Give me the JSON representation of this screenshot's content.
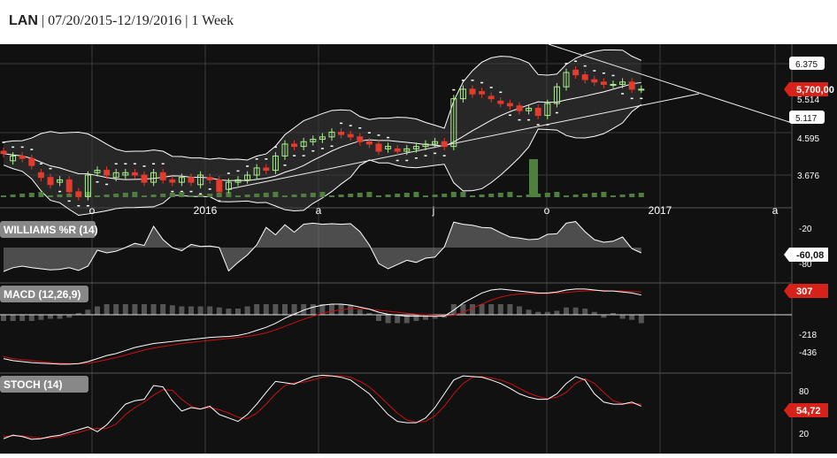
{
  "header": {
    "symbol": "LAN",
    "sep1": "|",
    "date_range": "07/20/2015-12/19/2016",
    "sep2": "|",
    "interval": "1 Week"
  },
  "chart_data": [
    {
      "panel": "price",
      "type": "candlestick",
      "y_ticks": [
        "6.375",
        "5.514",
        "5.117",
        "4.595",
        "3.676"
      ],
      "current_value_label": "5,700,00",
      "x_tick_labels": [
        "o",
        "2016",
        "a",
        "j",
        "o",
        "2017",
        "a"
      ],
      "candles": [
        [
          4.4,
          4.35
        ],
        [
          4.2,
          4.3
        ],
        [
          4.3,
          4.25
        ],
        [
          4.25,
          4.1
        ],
        [
          3.95,
          3.85
        ],
        [
          3.85,
          3.7
        ],
        [
          3.75,
          3.8
        ],
        [
          3.8,
          3.55
        ],
        [
          3.55,
          3.45
        ],
        [
          3.45,
          3.9
        ],
        [
          3.95,
          4.0
        ],
        [
          4.0,
          3.9
        ],
        [
          3.85,
          3.95
        ],
        [
          3.9,
          3.95
        ],
        [
          3.95,
          3.9
        ],
        [
          3.9,
          3.75
        ],
        [
          3.75,
          3.95
        ],
        [
          3.95,
          3.8
        ],
        [
          3.8,
          3.75
        ],
        [
          3.75,
          3.85
        ],
        [
          3.85,
          3.75
        ],
        [
          3.7,
          3.9
        ],
        [
          3.85,
          3.8
        ],
        [
          3.8,
          3.55
        ],
        [
          3.6,
          3.75
        ],
        [
          3.75,
          3.8
        ],
        [
          3.8,
          3.9
        ],
        [
          3.9,
          4.05
        ],
        [
          4.05,
          4.0
        ],
        [
          4.0,
          4.3
        ],
        [
          4.3,
          4.55
        ],
        [
          4.55,
          4.5
        ],
        [
          4.5,
          4.6
        ],
        [
          4.6,
          4.65
        ],
        [
          4.65,
          4.7
        ],
        [
          4.7,
          4.8
        ],
        [
          4.8,
          4.75
        ],
        [
          4.75,
          4.7
        ],
        [
          4.7,
          4.6
        ],
        [
          4.6,
          4.55
        ],
        [
          4.55,
          4.4
        ],
        [
          4.45,
          4.5
        ],
        [
          4.45,
          4.4
        ],
        [
          4.4,
          4.45
        ],
        [
          4.45,
          4.5
        ],
        [
          4.5,
          4.55
        ],
        [
          4.55,
          4.6
        ],
        [
          4.6,
          4.5
        ],
        [
          4.5,
          5.5
        ],
        [
          5.5,
          5.7
        ],
        [
          5.7,
          5.6
        ],
        [
          5.65,
          5.6
        ],
        [
          5.55,
          5.5
        ],
        [
          5.45,
          5.4
        ],
        [
          5.4,
          5.35
        ],
        [
          5.35,
          5.25
        ],
        [
          5.25,
          5.3
        ],
        [
          5.3,
          5.15
        ],
        [
          5.15,
          5.4
        ],
        [
          5.4,
          5.75
        ],
        [
          5.75,
          6.05
        ],
        [
          6.1,
          6.0
        ],
        [
          6.0,
          5.9
        ],
        [
          5.9,
          5.85
        ],
        [
          5.85,
          5.8
        ],
        [
          5.8,
          5.8
        ],
        [
          5.8,
          5.85
        ],
        [
          5.85,
          5.7
        ],
        [
          5.7,
          5.7
        ]
      ]
    },
    {
      "panel": "williams_r",
      "type": "line",
      "label": "WILLIAMS %R (14)",
      "y_ticks": [
        "-20",
        "-80"
      ],
      "current_value_label": "-60,08",
      "values": [
        -95,
        -88,
        -85,
        -88,
        -90,
        -92,
        -91,
        -88,
        -93,
        -85,
        -55,
        -60,
        -57,
        -50,
        -42,
        -46,
        -10,
        -35,
        -50,
        -56,
        -44,
        -48,
        -47,
        -50,
        -94,
        -78,
        -64,
        -45,
        -12,
        -26,
        -7,
        -21,
        -6,
        -4,
        -6,
        -5,
        -6,
        -5,
        -20,
        -45,
        -80,
        -90,
        -82,
        -74,
        -78,
        -70,
        -68,
        -49,
        -2,
        -6,
        -8,
        -12,
        -13,
        -22,
        -30,
        -32,
        -35,
        -34,
        -25,
        -24,
        -4,
        -1,
        -20,
        -35,
        -40,
        -38,
        -30,
        -52,
        -60
      ]
    },
    {
      "panel": "macd",
      "type": "line",
      "label": "MACD (12,26,9)",
      "y_ticks": [
        "-218",
        "-436"
      ],
      "current_value_label": "307",
      "macd": [
        -400,
        -420,
        -430,
        -440,
        -445,
        -450,
        -455,
        -455,
        -450,
        -430,
        -400,
        -370,
        -350,
        -320,
        -290,
        -270,
        -250,
        -240,
        -230,
        -220,
        -210,
        -200,
        -190,
        -185,
        -180,
        -170,
        -150,
        -120,
        -90,
        -50,
        0,
        40,
        80,
        110,
        130,
        140,
        140,
        130,
        110,
        90,
        60,
        40,
        30,
        20,
        20,
        20,
        20,
        20,
        80,
        150,
        200,
        250,
        280,
        290,
        280,
        270,
        260,
        250,
        250,
        260,
        280,
        290,
        290,
        280,
        270,
        270,
        260,
        250,
        230
      ],
      "signal": [
        -380,
        -400,
        -410,
        -420,
        -430,
        -440,
        -445,
        -450,
        -450,
        -445,
        -430,
        -410,
        -390,
        -365,
        -340,
        -315,
        -295,
        -280,
        -265,
        -250,
        -240,
        -230,
        -220,
        -210,
        -200,
        -190,
        -180,
        -165,
        -145,
        -115,
        -80,
        -45,
        -10,
        20,
        50,
        70,
        85,
        95,
        95,
        90,
        80,
        70,
        60,
        50,
        40,
        35,
        30,
        25,
        30,
        60,
        100,
        140,
        180,
        210,
        230,
        240,
        245,
        245,
        245,
        250,
        255,
        265,
        270,
        275,
        275,
        270,
        270,
        265,
        260
      ]
    },
    {
      "panel": "stochastic",
      "type": "line",
      "label": "STOCH (14)",
      "y_ticks": [
        "80",
        "20"
      ],
      "current_value_label": "54,72",
      "k": [
        5,
        10,
        8,
        4,
        5,
        8,
        10,
        14,
        18,
        22,
        15,
        25,
        40,
        55,
        60,
        62,
        82,
        80,
        60,
        45,
        50,
        48,
        52,
        40,
        35,
        30,
        40,
        55,
        72,
        88,
        86,
        84,
        90,
        95,
        97,
        96,
        94,
        90,
        80,
        70,
        55,
        40,
        30,
        28,
        28,
        35,
        50,
        70,
        90,
        96,
        95,
        94,
        90,
        85,
        78,
        70,
        65,
        62,
        62,
        70,
        85,
        95,
        90,
        70,
        58,
        55,
        55,
        58,
        52
      ],
      "d": [
        8,
        9,
        9,
        7,
        6,
        6,
        8,
        11,
        14,
        18,
        20,
        20,
        26,
        40,
        50,
        58,
        68,
        76,
        75,
        62,
        52,
        48,
        50,
        47,
        42,
        36,
        34,
        42,
        55,
        70,
        82,
        86,
        87,
        90,
        94,
        96,
        96,
        94,
        88,
        80,
        68,
        55,
        42,
        32,
        29,
        30,
        38,
        52,
        70,
        85,
        94,
        95,
        93,
        90,
        85,
        78,
        71,
        66,
        63,
        65,
        72,
        85,
        92,
        85,
        72,
        60,
        56,
        56,
        55
      ]
    }
  ],
  "colors": {
    "background": "#111111",
    "up_candle": "#a9f08a",
    "down_candle": "#e33b2e",
    "band_fill": "#3a3a3a",
    "line_white": "#ffffff",
    "signal_red": "#cc1111",
    "volume": "#4f7f3f",
    "histogram": "#555555",
    "value_tag": "#d62218",
    "label_pill": "#888888"
  }
}
